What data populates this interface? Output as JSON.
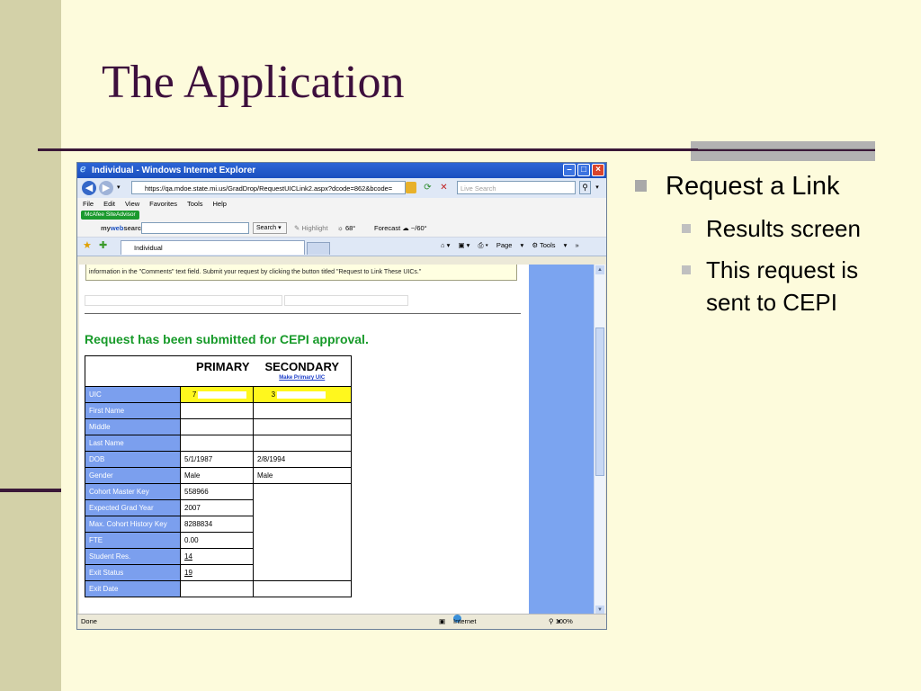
{
  "slide": {
    "title": "The Application",
    "bullets": {
      "main": "Request a Link",
      "sub": [
        "Results screen",
        "This request is sent to CEPI"
      ]
    }
  },
  "browser": {
    "window_title": "Individual - Windows Internet Explorer",
    "url": "https://qa.mdoe.state.mi.us/GradDrop/RequestUICLink2.aspx?dcode=862&bcode=",
    "live_search_placeholder": "Live Search",
    "menu": [
      "File",
      "Edit",
      "View",
      "Favorites",
      "Tools",
      "Help"
    ],
    "mcafee_label": "McAfee SiteAdvisor",
    "websearch": {
      "brand_prefix": "my",
      "brand_mid": "web",
      "brand_suffix": "search",
      "button": "Search",
      "highlight": "Highlight",
      "temperature": "68°",
      "forecast": "Forecast",
      "forecast_value": "~/60°"
    },
    "tab_label": "Individual",
    "command_bar": {
      "page": "Page",
      "tools": "Tools"
    },
    "status": {
      "left": "Done",
      "zone": "Internet",
      "zoom": "100%"
    }
  },
  "page": {
    "notice_text": "information in the \"Comments\" text field. Submit your request by clicking the button titled \"Request to Link These UICs.\"",
    "success_message": "Request has been submitted for CEPI approval.",
    "table": {
      "header_primary": "PRIMARY",
      "header_secondary": "SECONDARY",
      "make_primary_link": "Make Primary UIC",
      "uic": {
        "label": "UIC",
        "primary": "7",
        "secondary": "3"
      },
      "rows": [
        {
          "label": "First Name",
          "primary": "",
          "secondary": ""
        },
        {
          "label": "Middle",
          "primary": "",
          "secondary": ""
        },
        {
          "label": "Last Name",
          "primary": "",
          "secondary": ""
        },
        {
          "label": "DOB",
          "primary": "5/1/1987",
          "secondary": "2/8/1994"
        },
        {
          "label": "Gender",
          "primary": "Male",
          "secondary": "Male"
        },
        {
          "label": "Cohort Master Key",
          "primary": "558966"
        },
        {
          "label": "Expected Grad Year",
          "primary": "2007"
        },
        {
          "label": "Max. Cohort History Key",
          "primary": "8288834"
        },
        {
          "label": "FTE",
          "primary": "0.00"
        },
        {
          "label": "Student Res.",
          "primary": "14"
        },
        {
          "label": "Exit Status",
          "primary": "19"
        },
        {
          "label": "Exit Date",
          "primary": "",
          "secondary": ""
        }
      ]
    }
  }
}
